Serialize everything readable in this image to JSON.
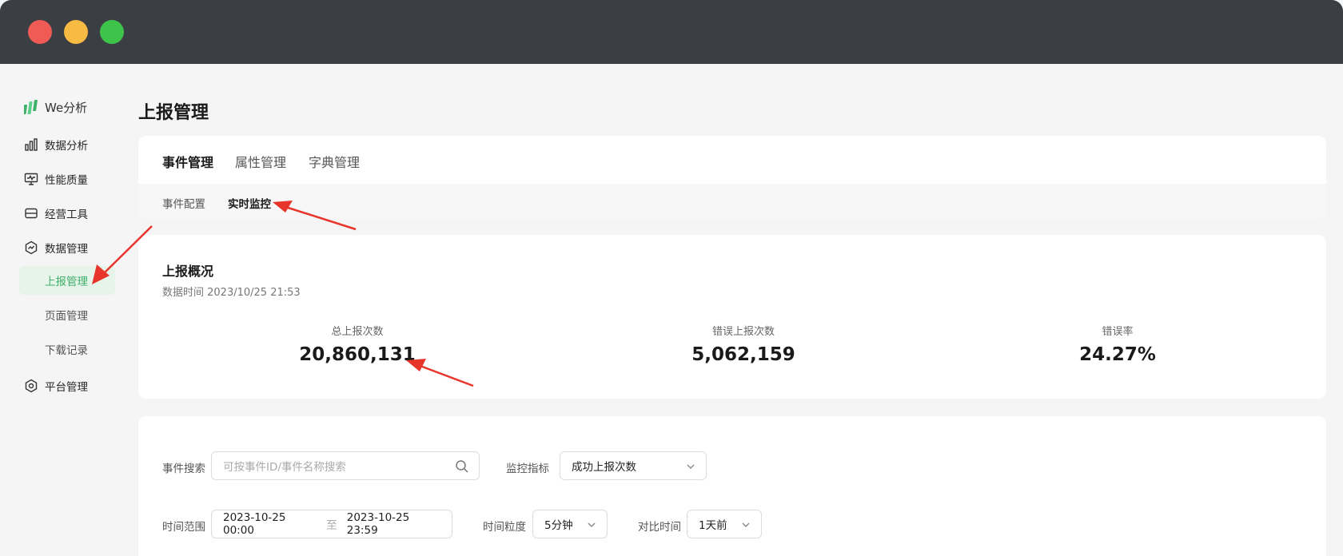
{
  "sidebar": {
    "brand": "We分析",
    "items": [
      {
        "label": "数据分析",
        "icon": "bar-chart-icon"
      },
      {
        "label": "性能质量",
        "icon": "monitor-icon"
      },
      {
        "label": "经营工具",
        "icon": "wallet-icon"
      },
      {
        "label": "数据管理",
        "icon": "data-hexagon-icon"
      },
      {
        "label": "平台管理",
        "icon": "hexagon-gear-icon"
      }
    ],
    "subitems": [
      {
        "label": "上报管理",
        "active": true
      },
      {
        "label": "页面管理",
        "active": false
      },
      {
        "label": "下载记录",
        "active": false
      }
    ]
  },
  "page": {
    "title": "上报管理"
  },
  "tabs": [
    "事件管理",
    "属性管理",
    "字典管理"
  ],
  "subtabs": [
    "事件配置",
    "实时监控"
  ],
  "overview": {
    "title": "上报概况",
    "time": "数据时间 2023/10/25 21:53",
    "metrics": [
      {
        "label": "总上报次数",
        "value": "20,860,131"
      },
      {
        "label": "错误上报次数",
        "value": "5,062,159"
      },
      {
        "label": "错误率",
        "value": "24.27%"
      }
    ]
  },
  "filters": {
    "event_search_label": "事件搜索",
    "event_search_placeholder": "可按事件ID/事件名称搜索",
    "monitor_label": "监控指标",
    "monitor_value": "成功上报次数",
    "time_range_label": "时间范围",
    "time_start": "2023-10-25 00:00",
    "time_to": "至",
    "time_end": "2023-10-25 23:59",
    "granularity_label": "时间粒度",
    "granularity_value": "5分钟",
    "compare_label": "对比时间",
    "compare_value": "1天前"
  },
  "colors": {
    "accent": "#3fb06a",
    "titlebar": "#3b3e42",
    "annotation_arrow": "#e8352b"
  }
}
